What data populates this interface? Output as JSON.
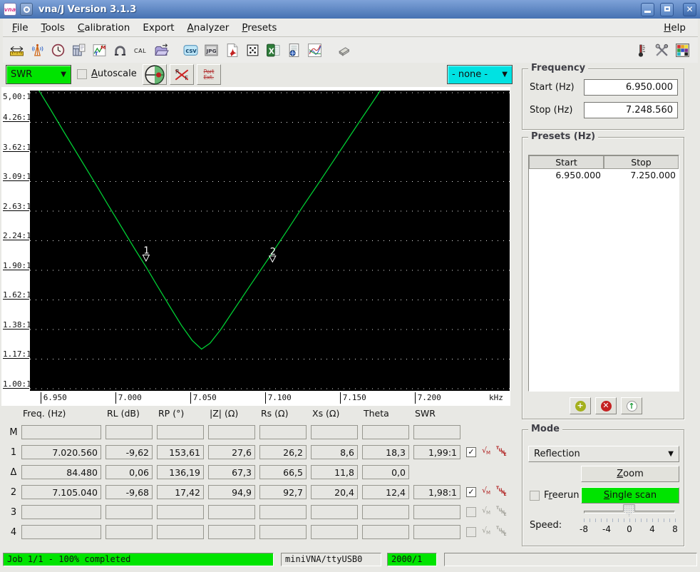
{
  "window": {
    "title": "vna/J Version 3.1.3",
    "logo_text": "vna",
    "buttons": {
      "minimize": "minimize",
      "maximize": "maximize",
      "close": "close"
    }
  },
  "menu": {
    "items": [
      {
        "label": "File",
        "mnemonic": 0
      },
      {
        "label": "Tools",
        "mnemonic": 0
      },
      {
        "label": "Calibration",
        "mnemonic": 0
      },
      {
        "label": "Export",
        "mnemonic": -1
      },
      {
        "label": "Analyzer",
        "mnemonic": 0
      },
      {
        "label": "Presets",
        "mnemonic": 0
      }
    ],
    "help": {
      "label": "Help",
      "mnemonic": 0
    }
  },
  "toolbar": {
    "left_icons": [
      {
        "name": "frequency-sweep-icon"
      },
      {
        "name": "antenna-icon"
      },
      {
        "name": "clock-icon"
      },
      {
        "name": "calculator-icon"
      },
      {
        "name": "marker-tune-icon",
        "label_m": "M",
        "label_t": "T"
      },
      {
        "name": "magnet-icon"
      },
      {
        "name": "cal-icon",
        "label": "CAL"
      },
      {
        "name": "open-calibration-folder-icon"
      },
      {
        "name": "export-csv-icon",
        "label": "csv",
        "gap_before": true
      },
      {
        "name": "export-jpg-icon",
        "label": "JPG"
      },
      {
        "name": "export-pdf-icon"
      },
      {
        "name": "export-snp-dice-icon"
      },
      {
        "name": "export-xls-icon",
        "label": "X"
      },
      {
        "name": "report-icon"
      },
      {
        "name": "chart-curves-icon"
      },
      {
        "name": "eraser-icon",
        "gap_before": true
      }
    ],
    "right_icons": [
      {
        "name": "thermometer-icon"
      },
      {
        "name": "settings-tools-icon"
      },
      {
        "name": "palette-icon"
      }
    ]
  },
  "chart_controls": {
    "trace_select": "SWR",
    "autoscale": {
      "label": "Autoscale",
      "mnemonic": 0,
      "checked": false
    },
    "smith_button": "smith-chart",
    "rf_letters": {
      "r": "R",
      "f": "F"
    },
    "portext": {
      "line1": "Port",
      "line2": "Ext."
    },
    "right_select": "- none -"
  },
  "chart_data": {
    "type": "line",
    "title": "SWR vs frequency sweep",
    "x_unit_label": "kHz",
    "y_scale": "log",
    "ylim": [
      1.0,
      5.0
    ],
    "xlim_khz": [
      6943,
      7263
    ],
    "grid": "horizontal-dotted",
    "y_ticks": [
      "5,00:1",
      "4.26:1",
      "3.62:1",
      "3.09:1",
      "2.63:1",
      "2.24:1",
      "1.90:1",
      "1.62:1",
      "1.38:1",
      "1.17:1",
      "1.00:1"
    ],
    "x_ticks": [
      {
        "label": "6.950",
        "f": 6950
      },
      {
        "label": "7.000",
        "f": 7000
      },
      {
        "label": "7.050",
        "f": 7050
      },
      {
        "label": "7.100",
        "f": 7100
      },
      {
        "label": "7.150",
        "f": 7150
      },
      {
        "label": "7.200",
        "f": 7200
      }
    ],
    "series": [
      {
        "name": "SWR",
        "color": "#00cc33",
        "points": [
          [
            6949.0,
            5.06
          ],
          [
            6956.2,
            4.6
          ],
          [
            6965.7,
            4.04
          ],
          [
            6975.2,
            3.56
          ],
          [
            6984.8,
            3.13
          ],
          [
            6994.3,
            2.75
          ],
          [
            7003.8,
            2.42
          ],
          [
            7013.3,
            2.13
          ],
          [
            7020.5,
            1.94
          ],
          [
            7027.6,
            1.76
          ],
          [
            7037.1,
            1.55
          ],
          [
            7044.3,
            1.41
          ],
          [
            7051.4,
            1.3
          ],
          [
            7057.6,
            1.24
          ],
          [
            7063.3,
            1.28
          ],
          [
            7070.5,
            1.38
          ],
          [
            7080.0,
            1.55
          ],
          [
            7089.5,
            1.74
          ],
          [
            7099.0,
            1.95
          ],
          [
            7102.4,
            2.03
          ],
          [
            7115.7,
            2.39
          ],
          [
            7125.2,
            2.69
          ],
          [
            7134.8,
            3.02
          ],
          [
            7144.3,
            3.39
          ],
          [
            7153.8,
            3.81
          ],
          [
            7163.3,
            4.28
          ],
          [
            7170.5,
            4.67
          ],
          [
            7177.1,
            5.06
          ]
        ]
      }
    ],
    "markers": [
      {
        "label": "1",
        "f": 7020.56,
        "swr": 1.99
      },
      {
        "label": "2",
        "f": 7105.04,
        "swr": 1.98
      }
    ]
  },
  "table": {
    "headers": [
      "Freq. (Hz)",
      "RL (dB)",
      "RP (°)",
      "|Z| (Ω)",
      "Rs (Ω)",
      "Xs (Ω)",
      "Theta",
      "SWR"
    ],
    "rows": [
      {
        "label": "M",
        "cells": [
          "",
          "",
          "",
          "",
          "",
          "",
          "",
          ""
        ],
        "checkbox": null,
        "icons": null
      },
      {
        "label": "1",
        "cells": [
          "7.020.560",
          "-9,62",
          "153,61",
          "27,6",
          "26,2",
          "8,6",
          "18,3",
          "1,99:1"
        ],
        "checkbox": "checked",
        "icons": "active"
      },
      {
        "label": "Δ",
        "cells": [
          "84.480",
          "0,06",
          "136,19",
          "67,3",
          "66,5",
          "11,8",
          "0,0"
        ],
        "checkbox": null,
        "icons": null
      },
      {
        "label": "2",
        "cells": [
          "7.105.040",
          "-9,68",
          "17,42",
          "94,9",
          "92,7",
          "20,4",
          "12,4",
          "1,98:1"
        ],
        "checkbox": "checked",
        "icons": "active"
      },
      {
        "label": "3",
        "cells": [
          "",
          "",
          "",
          "",
          "",
          "",
          "",
          ""
        ],
        "checkbox": "unchecked",
        "icons": "disabled"
      },
      {
        "label": "4",
        "cells": [
          "",
          "",
          "",
          "",
          "",
          "",
          "",
          ""
        ],
        "checkbox": "unchecked",
        "icons": "disabled"
      }
    ],
    "marker_icons": {
      "sqrt": "√",
      "sqrt_sub": "M",
      "tune": [
        "T",
        "U",
        "N",
        "E"
      ]
    }
  },
  "frequency": {
    "legend": "Frequency",
    "start_label": "Start (Hz)",
    "start_value": "6.950.000",
    "stop_label": "Stop (Hz)",
    "stop_value": "7.248.560"
  },
  "presets": {
    "legend": "Presets (Hz)",
    "headers": [
      "Start",
      "Stop"
    ],
    "rows": [
      [
        "6.950.000",
        "7.250.000"
      ]
    ],
    "buttons": {
      "add": "+",
      "delete": "✕",
      "apply": "↑"
    }
  },
  "mode": {
    "legend": "Mode",
    "selected": "Reflection",
    "zoom": {
      "label": "Zoom",
      "mnemonic": 0
    },
    "freerun": {
      "label": "Freerun",
      "mnemonic": 1,
      "checked": false
    },
    "single_scan": {
      "label": "Single scan",
      "mnemonic": 0
    },
    "speed_label": "Speed:",
    "speed_tick_labels": [
      "-8",
      "-4",
      "0",
      "4",
      "8"
    ],
    "speed_value": 0,
    "speed_range": [
      -8,
      8
    ]
  },
  "status": {
    "job": "Job 1/1 - 100% completed",
    "device": "miniVNA/ttyUSB0",
    "samples": "2000/1"
  },
  "colors": {
    "accent_green": "#00e400",
    "accent_cyan": "#00e2e2",
    "curve_green": "#00cc33",
    "titlebar_blue": "#4672b2",
    "marker_red": "#b02020"
  }
}
